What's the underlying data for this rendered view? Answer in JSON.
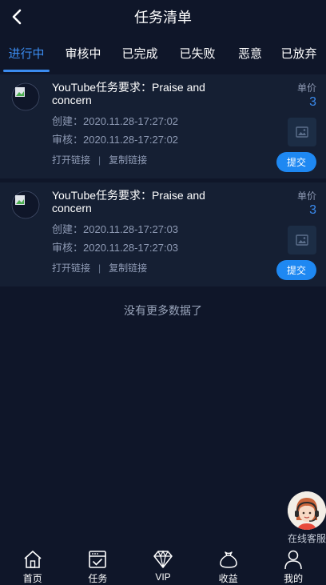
{
  "header": {
    "title": "任务清单"
  },
  "tabs": [
    {
      "label": "进行中",
      "active": true
    },
    {
      "label": "审核中",
      "active": false
    },
    {
      "label": "已完成",
      "active": false
    },
    {
      "label": "已失败",
      "active": false
    },
    {
      "label": "恶意",
      "active": false
    },
    {
      "label": "已放弃",
      "active": false
    }
  ],
  "tasks": [
    {
      "title": "YouTube任务要求：Praise and concern",
      "created": "创建：2020.11.28-17:27:02",
      "reviewed": "审核：2020.11.28-17:27:02",
      "open_link": "打开链接",
      "separator": "|",
      "copy_link": "复制链接",
      "price_label": "单价",
      "price_value": "3",
      "submit_label": "提交"
    },
    {
      "title": "YouTube任务要求：Praise and concern",
      "created": "创建：2020.11.28-17:27:03",
      "reviewed": "审核：2020.11.28-17:27:03",
      "open_link": "打开链接",
      "separator": "|",
      "copy_link": "复制链接",
      "price_label": "单价",
      "price_value": "3",
      "submit_label": "提交"
    }
  ],
  "no_more_text": "没有更多数据了",
  "service": {
    "label": "在线客服"
  },
  "tabbar": [
    {
      "label": "首页",
      "icon": "home-icon"
    },
    {
      "label": "任务",
      "icon": "task-icon"
    },
    {
      "label": "VIP",
      "icon": "diamond-icon"
    },
    {
      "label": "收益",
      "icon": "money-bag-icon"
    },
    {
      "label": "我的",
      "icon": "user-icon"
    }
  ],
  "colors": {
    "background": "#0f1629",
    "card": "#151f33",
    "accent": "#3b8cf0",
    "button": "#1e88f2"
  }
}
